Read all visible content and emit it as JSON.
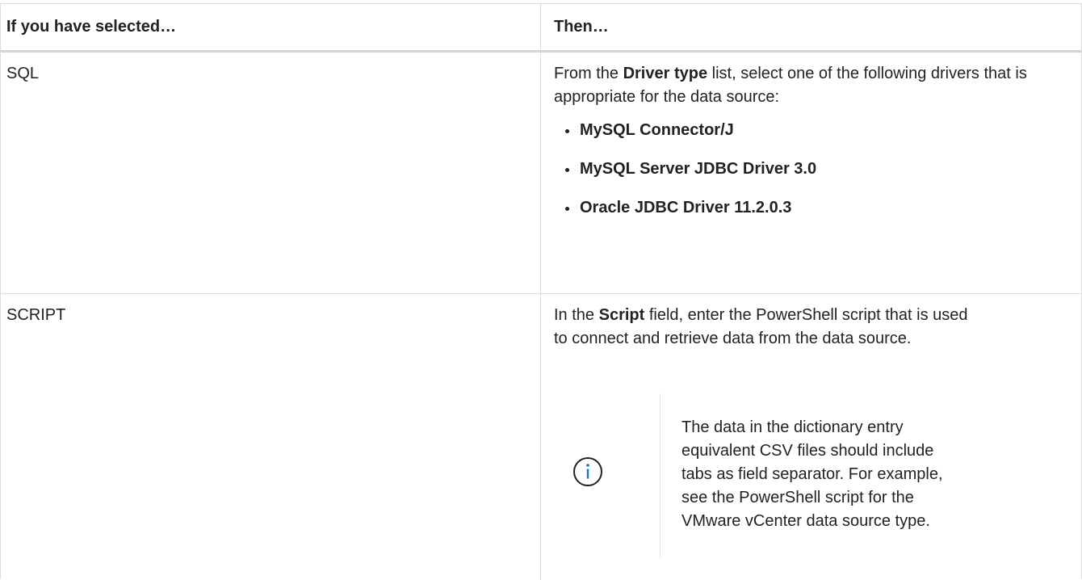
{
  "table": {
    "headers": {
      "col1": "If you have selected…",
      "col2": "Then…"
    },
    "rows": [
      {
        "selection": "SQL",
        "intro_before": "From the ",
        "intro_bold": "Driver type",
        "intro_after": " list, select one of the following drivers that is appropriate for the data source:",
        "drivers": [
          "MySQL Connector/J",
          "MySQL Server JDBC Driver 3.0",
          "Oracle JDBC Driver 11.2.0.3"
        ]
      },
      {
        "selection": "SCRIPT",
        "intro_before": "In the ",
        "intro_bold": "Script",
        "intro_after": " field, enter the PowerShell script that is used to connect and retrieve data from the data source.",
        "note": {
          "icon": "info-icon",
          "text": "The data in the dictionary entry equivalent CSV files should include tabs as field separator. For example, see the PowerShell script for the VMware vCenter data source type."
        }
      }
    ]
  },
  "colors": {
    "text": "#222222",
    "border": "#dcdcdc",
    "accent": "#1a73c8"
  }
}
